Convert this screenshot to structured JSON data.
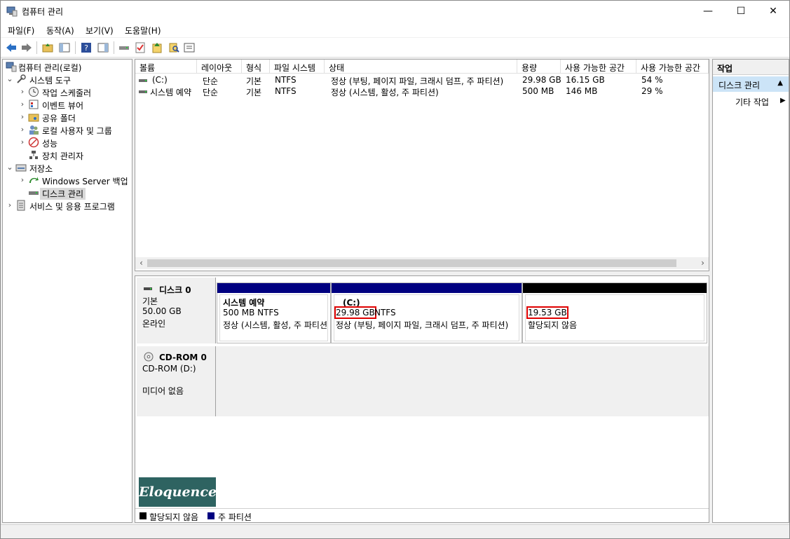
{
  "window": {
    "title": "컴퓨터 관리",
    "minimize": "—",
    "maximize": "☐",
    "close": "✕"
  },
  "menu": [
    "파일(F)",
    "동작(A)",
    "보기(V)",
    "도움말(H)"
  ],
  "tree": {
    "root": "컴퓨터 관리(로컬)",
    "system_tools": "시스템 도구",
    "task_scheduler": "작업 스케줄러",
    "event_viewer": "이벤트 뷰어",
    "shared_folders": "공유 폴더",
    "local_users": "로컬 사용자 및 그룹",
    "performance": "성능",
    "device_manager": "장치 관리자",
    "storage": "저장소",
    "windows_backup": "Windows Server 백업",
    "disk_management": "디스크 관리",
    "services": "서비스 및 응용 프로그램"
  },
  "volumes": {
    "columns": [
      "볼륨",
      "레이아웃",
      "형식",
      "파일 시스템",
      "상태",
      "용량",
      "사용 가능한 공간",
      "사용 가능한 공간"
    ],
    "rows": [
      [
        "(C:)",
        "단순",
        "기본",
        "NTFS",
        "정상 (부팅, 페이지 파일, 크래시 덤프, 주 파티션)",
        "29.98 GB",
        "16.15 GB",
        "54 %"
      ],
      [
        "시스템 예약",
        "단순",
        "기본",
        "NTFS",
        "정상 (시스템, 활성, 주 파티션)",
        "500 MB",
        "146 MB",
        "29 %"
      ]
    ]
  },
  "disk0": {
    "name": "디스크 0",
    "type": "기본",
    "size": "50.00 GB",
    "status": "온라인",
    "partitions": {
      "reserved": {
        "name": "시스템 예약",
        "size": "500 MB NTFS",
        "status": "정상 (시스템, 활성, 주 파티션)"
      },
      "c": {
        "name": "(C:)",
        "size": "29.98 GB",
        "fs": "NTFS",
        "status": "정상 (부팅, 페이지 파일, 크래시 덤프, 주 파티션)"
      },
      "unalloc": {
        "size": "19.53 GB",
        "status": "할당되지 않음"
      }
    }
  },
  "cdrom": {
    "name": "CD-ROM 0",
    "drive": "CD-ROM (D:)",
    "status": "미디어 없음"
  },
  "logo_text": "Eloquence",
  "legend": {
    "unallocated": "할당되지 않음",
    "primary": "주 파티션"
  },
  "actions": {
    "header": "작업",
    "section": "디스크 관리",
    "more": "기타 작업"
  },
  "colors": {
    "primary_partition": "#000080",
    "unallocated": "#000000",
    "highlight": "#e00000",
    "selection": "#cce4f7"
  }
}
